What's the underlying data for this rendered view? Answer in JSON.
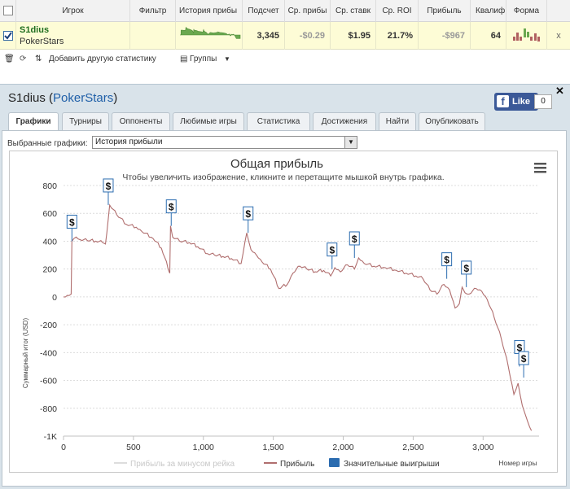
{
  "table": {
    "headers": {
      "player": "Игрок",
      "filter": "Фильтр",
      "history": "История прибы",
      "count": "Подсчет",
      "avg_profit": "Ср. прибы",
      "avg_stake": "Ср. ставк",
      "avg_roi": "Ср. ROI",
      "profit": "Прибыль",
      "qual": "Квалиф",
      "form": "Форма"
    },
    "row": {
      "name": "S1dius",
      "room": "PokerStars",
      "count": "3,345",
      "avg_profit": "-$0.29",
      "avg_stake": "$1.95",
      "avg_roi": "21.7%",
      "profit": "-$967",
      "qual": "64",
      "remove": "x"
    },
    "toolbar": {
      "add_stats": "Добавить другую статистику",
      "groups": "Группы"
    }
  },
  "player_panel": {
    "name": "S1dius",
    "room": "PokerStars",
    "fb_like": "Like",
    "fb_count": "0",
    "tabs": [
      "Графики",
      "Турниры",
      "Оппоненты",
      "Любимые игры",
      "Статистика",
      "Достижения",
      "Найти",
      "Опубликовать"
    ],
    "active_tab": 0,
    "chart_select_label": "Выбранные графики:",
    "chart_select_value": "История прибыли"
  },
  "colors": {
    "line": "#b06e6e",
    "rake_line": "#dddddd",
    "marker": "#2b6cb0",
    "sparkline": "#6aa84f"
  },
  "chart_data": {
    "type": "line",
    "title": "Общая прибыль",
    "subtitle": "Чтобы увеличить изображение, кликните и перетащите мышкой внутрь графика.",
    "ylabel": "Суммарный итог (USD)",
    "xlabel": "Номер игры",
    "xlim": [
      0,
      3400
    ],
    "ylim": [
      -1000,
      800
    ],
    "xticks": [
      "0",
      "500",
      "1,000",
      "1,500",
      "2,000",
      "2,500",
      "3,000"
    ],
    "xtick_values": [
      0,
      500,
      1000,
      1500,
      2000,
      2500,
      3000
    ],
    "yticks": [
      "800",
      "600",
      "400",
      "200",
      "0",
      "-200",
      "-400",
      "-600",
      "-800",
      "-1K"
    ],
    "ytick_values": [
      800,
      600,
      400,
      200,
      0,
      -200,
      -400,
      -600,
      -800,
      -1000
    ],
    "legend": [
      "Прибыль за минусом рейка",
      "Прибыль",
      "Значительные выигрыши"
    ],
    "legend_position": "bottom",
    "grid": true,
    "series": [
      {
        "name": "Прибыль",
        "x": [
          0,
          40,
          55,
          60,
          75,
          90,
          120,
          170,
          230,
          280,
          300,
          310,
          330,
          380,
          450,
          520,
          560,
          640,
          700,
          760,
          765,
          780,
          830,
          900,
          960,
          1030,
          1080,
          1140,
          1200,
          1270,
          1310,
          1340,
          1380,
          1420,
          1480,
          1540,
          1600,
          1640,
          1690,
          1740,
          1800,
          1860,
          1910,
          1940,
          1980,
          2030,
          2080,
          2110,
          2150,
          2220,
          2300,
          2380,
          2450,
          2520,
          2570,
          2620,
          2670,
          2720,
          2760,
          2800,
          2830,
          2850,
          2870,
          2900,
          2950,
          2990,
          3030,
          3080,
          3130,
          3180,
          3220,
          3250,
          3280,
          3300,
          3320,
          3345
        ],
        "y": [
          0,
          10,
          20,
          400,
          420,
          430,
          410,
          405,
          400,
          390,
          380,
          460,
          660,
          590,
          520,
          500,
          470,
          420,
          350,
          170,
          510,
          430,
          400,
          390,
          360,
          310,
          300,
          290,
          275,
          240,
          460,
          340,
          300,
          250,
          200,
          60,
          90,
          170,
          220,
          200,
          180,
          190,
          150,
          210,
          180,
          230,
          200,
          280,
          240,
          220,
          210,
          190,
          170,
          150,
          130,
          50,
          20,
          90,
          50,
          -80,
          -50,
          70,
          30,
          20,
          60,
          40,
          -20,
          -150,
          -300,
          -500,
          -700,
          -620,
          -780,
          -840,
          -900,
          -960
        ]
      },
      {
        "name": "Прибыль за минусом рейка",
        "x": [],
        "y": []
      }
    ],
    "markers": [
      {
        "name": "Значительные выигрыши",
        "x": [
          60,
          320,
          770,
          1320,
          1920,
          2080,
          2740,
          2880,
          3260,
          3290
        ],
        "y": [
          400,
          660,
          510,
          460,
          200,
          280,
          130,
          70,
          -500,
          -580
        ],
        "label": "$"
      }
    ]
  }
}
